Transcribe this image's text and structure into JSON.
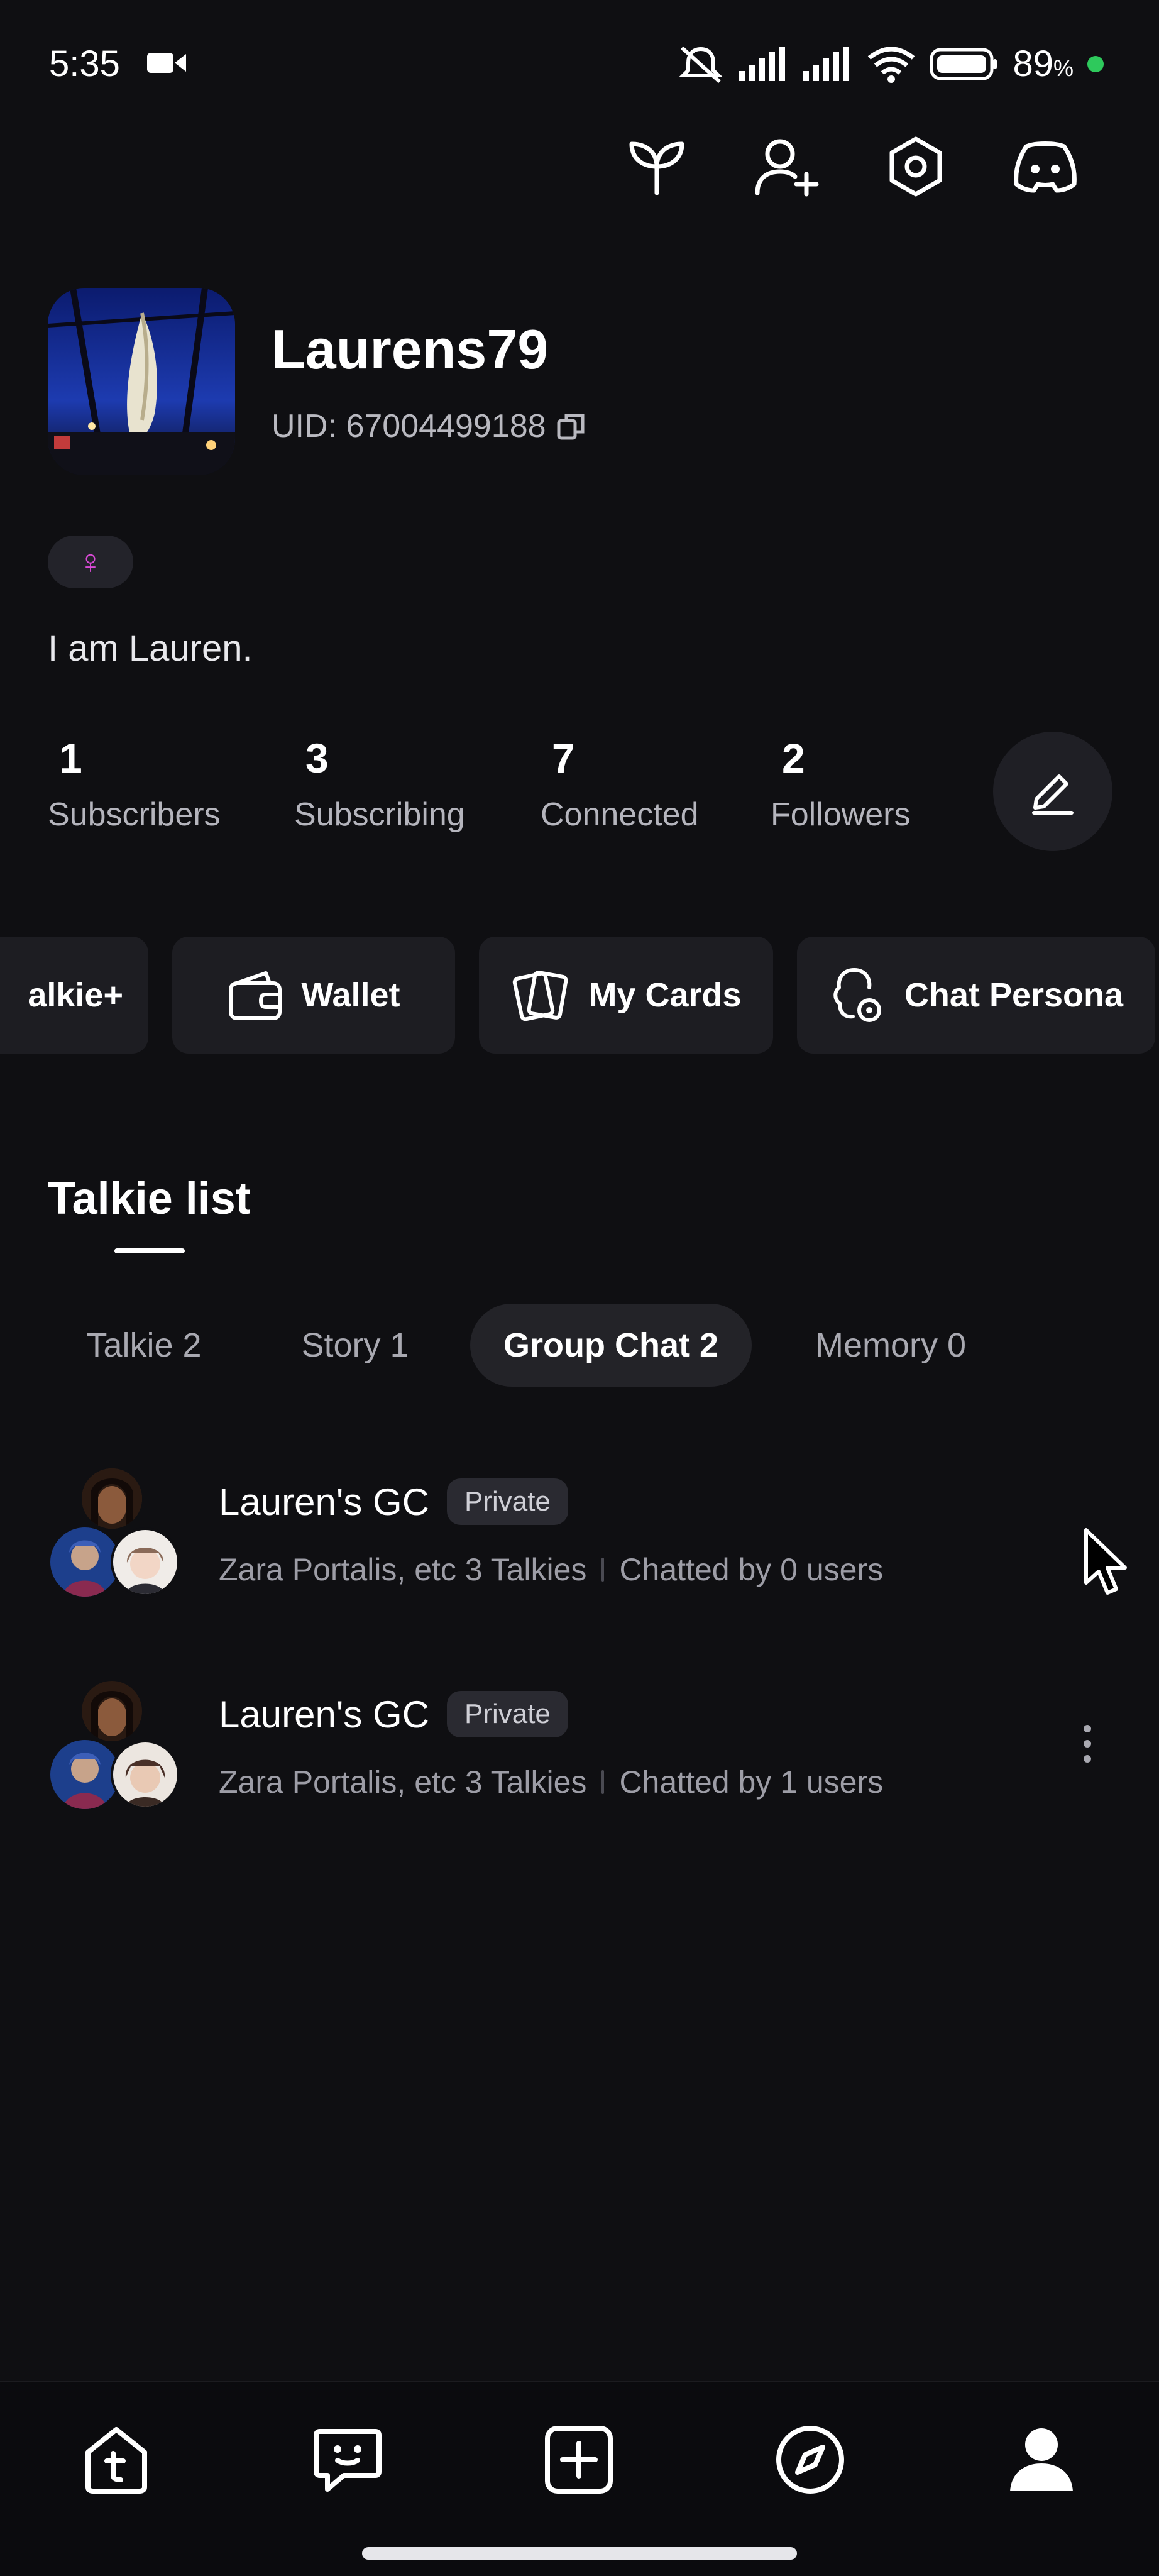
{
  "status_bar": {
    "time": "5:35",
    "battery": "89",
    "battery_unit": "%",
    "icons": [
      "video-record-icon",
      "mute-icon",
      "signal-icon",
      "signal-icon",
      "wifi-icon",
      "battery-icon",
      "battery-charge-dot"
    ]
  },
  "top_actions": [
    "sprout-icon",
    "add-friend-icon",
    "settings-icon",
    "discord-icon"
  ],
  "profile": {
    "username": "Laurens79",
    "uid": "UID: 67004499188",
    "gender_symbol": "♀",
    "bio": "I am Lauren."
  },
  "stats": [
    {
      "value": "1",
      "label": "Subscribers"
    },
    {
      "value": "3",
      "label": "Subscribing"
    },
    {
      "value": "7",
      "label": "Connected"
    },
    {
      "value": "2",
      "label": "Followers"
    }
  ],
  "cards": [
    {
      "label": "alkie+"
    },
    {
      "label": "Wallet"
    },
    {
      "label": "My Cards"
    },
    {
      "label": "Chat Persona"
    }
  ],
  "talkie_list": {
    "title": "Talkie list",
    "tabs": [
      {
        "label": "Talkie 2",
        "active": false
      },
      {
        "label": "Story 1",
        "active": false
      },
      {
        "label": "Group Chat 2",
        "active": true
      },
      {
        "label": "Memory 0",
        "active": false
      }
    ],
    "items": [
      {
        "title": "Lauren's GC",
        "badge": "Private",
        "members": "Zara Portalis, etc 3 Talkies",
        "chatted": "Chatted by 0 users"
      },
      {
        "title": "Lauren's GC",
        "badge": "Private",
        "members": "Zara Portalis, etc 3 Talkies",
        "chatted": "Chatted by 1 users"
      }
    ]
  },
  "bottom_nav": [
    "home-icon",
    "messages-icon",
    "create-icon",
    "explore-icon",
    "profile-icon"
  ],
  "colors": {
    "background": "#0f0f12",
    "card": "#1d1d22",
    "active_tab": "#232328",
    "gender": "#d94ad6",
    "battery_dot": "#2ec95c"
  }
}
